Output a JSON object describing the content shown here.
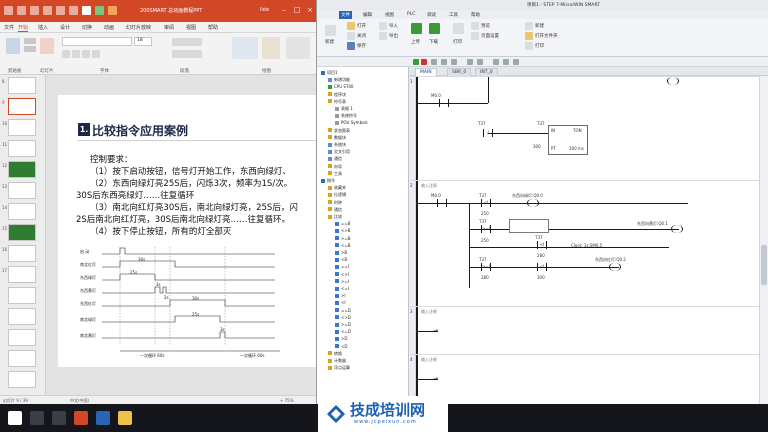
{
  "ppt": {
    "title": "200SMART 总动画教程PPT",
    "user": "lide",
    "tabs": [
      "文件",
      "开始",
      "插入",
      "设计",
      "切换",
      "动画",
      "幻灯片放映",
      "审阅",
      "视图",
      "帮助"
    ],
    "active_tab": "开始",
    "ribbon_groups": [
      "剪贴板",
      "幻灯片",
      "字体",
      "段落",
      "绘图"
    ],
    "ribbon_buttons": {
      "paste": "粘贴",
      "new_slide": "新建\n幻灯片",
      "font_size": "18"
    },
    "thumb_numbers": [
      "8",
      "9",
      "10",
      "11",
      "12",
      "13",
      "14",
      "15",
      "16",
      "17"
    ],
    "selected_thumb": "9",
    "slide": {
      "badge": "1.",
      "title": "比较指令应用案例",
      "heading": "控制要求：",
      "lines": [
        "（1）按下启动按钮，信号灯开始工作，东西向绿灯、",
        "（2）东西向绿灯亮25S后，闪烁3次，频率为1S/次。",
        "30S后东西亮绿灯……往复循环",
        "（3）南北向红灯亮30S后，南北向绿灯亮，25S后，闪",
        "2S后南北向红灯亮，30S后南北向绿灯亮……往复循环。",
        "（4）按下停止按钮，所有的灯全部灭"
      ],
      "timing_rows": [
        "启  动",
        "南北红灯",
        "东西绿灯",
        "东西黄灯",
        "东西红灯",
        "南北绿灯",
        "南北黄灯"
      ],
      "timing_labels": [
        "30s",
        "25s",
        "3s",
        "2s",
        "30s",
        "25s",
        "3s",
        "一次循环 60s",
        "一次循环 60s"
      ]
    },
    "status": {
      "left": "幻灯片 9 / 39",
      "lang": "中文(中国)",
      "zoom": "+ 75%"
    }
  },
  "plc": {
    "title": "项目1 - STEP 7-Micro/WIN SMART",
    "menu": [
      "文件",
      "编辑",
      "视图",
      "PLC",
      "调试",
      "工具",
      "帮助"
    ],
    "ribbon": {
      "buttons": [
        "新建",
        "打开",
        "关闭",
        "保存",
        "导入",
        "导出",
        "上传",
        "下载",
        "打印",
        "预览",
        "页面设置"
      ],
      "right_items": [
        "新建",
        "打开文件夹",
        "打印"
      ]
    },
    "editor_tabs": [
      "MAIN",
      "SBR_0",
      "INT_0"
    ],
    "active_editor_tab": "MAIN",
    "tree": [
      {
        "label": "项目1",
        "depth": 0,
        "color": "#2b6cc4"
      },
      {
        "label": "新增功能",
        "depth": 1,
        "color": "#5b8ed6"
      },
      {
        "label": "CPU ST40",
        "depth": 1,
        "color": "#3a9a3a"
      },
      {
        "label": "程序块",
        "depth": 1,
        "color": "#d9a321"
      },
      {
        "label": "符号表",
        "depth": 1,
        "color": "#d9a321"
      },
      {
        "label": "表格 1",
        "depth": 2,
        "color": "#9a9a9a"
      },
      {
        "label": "系统符号",
        "depth": 2,
        "color": "#9a9a9a"
      },
      {
        "label": "POU Symbols",
        "depth": 2,
        "color": "#9a9a9a"
      },
      {
        "label": "状态图表",
        "depth": 1,
        "color": "#d9a321"
      },
      {
        "label": "数据块",
        "depth": 1,
        "color": "#d9a321"
      },
      {
        "label": "系统块",
        "depth": 1,
        "color": "#5b8ed6"
      },
      {
        "label": "交叉引用",
        "depth": 1,
        "color": "#5b8ed6"
      },
      {
        "label": "通信",
        "depth": 1,
        "color": "#5b8ed6"
      },
      {
        "label": "向导",
        "depth": 1,
        "color": "#d9a321"
      },
      {
        "label": "工具",
        "depth": 1,
        "color": "#d9a321"
      },
      {
        "label": "指令",
        "depth": 0,
        "color": "#2b6cc4"
      },
      {
        "label": "收藏夹",
        "depth": 1,
        "color": "#d9a321"
      },
      {
        "label": "位逻辑",
        "depth": 1,
        "color": "#d9a321"
      },
      {
        "label": "时钟",
        "depth": 1,
        "color": "#d9a321"
      },
      {
        "label": "通信",
        "depth": 1,
        "color": "#d9a321"
      },
      {
        "label": "比较",
        "depth": 1,
        "color": "#d9a321"
      },
      {
        "label": "==B",
        "depth": 2,
        "color": "#3d78c8"
      },
      {
        "label": "<>B",
        "depth": 2,
        "color": "#3d78c8"
      },
      {
        "label": ">=B",
        "depth": 2,
        "color": "#3d78c8"
      },
      {
        "label": "<=B",
        "depth": 2,
        "color": "#3d78c8"
      },
      {
        "label": ">B",
        "depth": 2,
        "color": "#3d78c8"
      },
      {
        "label": "<B",
        "depth": 2,
        "color": "#3d78c8"
      },
      {
        "label": "==I",
        "depth": 2,
        "color": "#3d78c8"
      },
      {
        "label": "<>I",
        "depth": 2,
        "color": "#3d78c8"
      },
      {
        "label": ">=I",
        "depth": 2,
        "color": "#3d78c8"
      },
      {
        "label": "<=I",
        "depth": 2,
        "color": "#3d78c8"
      },
      {
        "label": ">I",
        "depth": 2,
        "color": "#3d78c8"
      },
      {
        "label": "<I",
        "depth": 2,
        "color": "#3d78c8"
      },
      {
        "label": "==D",
        "depth": 2,
        "color": "#3d78c8"
      },
      {
        "label": "<>D",
        "depth": 2,
        "color": "#3d78c8"
      },
      {
        "label": ">=D",
        "depth": 2,
        "color": "#3d78c8"
      },
      {
        "label": "<=D",
        "depth": 2,
        "color": "#3d78c8"
      },
      {
        "label": ">D",
        "depth": 2,
        "color": "#3d78c8"
      },
      {
        "label": "<D",
        "depth": 2,
        "color": "#3d78c8"
      },
      {
        "label": "转换",
        "depth": 1,
        "color": "#d9a321"
      },
      {
        "label": "计数器",
        "depth": 1,
        "color": "#d9a321"
      },
      {
        "label": "浮点运算",
        "depth": 1,
        "color": "#d9a321"
      }
    ],
    "networks": [
      {
        "num": "1",
        "comment": "",
        "contacts": [
          "M0.0"
        ]
      },
      {
        "num": "2",
        "comment": "输入注释",
        "contacts": [
          "M0.0",
          "T37",
          "T37",
          "T37",
          "T37"
        ],
        "coils": [
          "东西向绿灯:Q0.0",
          "东西向黄灯:Q0.1",
          "东西向红灯:Q0.2"
        ],
        "compare_values": [
          "250",
          "250",
          "280",
          "280",
          "300"
        ],
        "clock": "Clock_1s:SM0.5"
      },
      {
        "num": "3",
        "comment": "输入注释"
      },
      {
        "num": "4",
        "comment": "输入注释"
      }
    ],
    "net1": {
      "timer": "T37",
      "timer_type": "TON",
      "in": "IN",
      "pt": "PT",
      "pt_value": "300",
      "unit": "100 ms",
      "contact": "T37"
    }
  },
  "brand": {
    "title": "技成培训网",
    "sub": "www.jcpeixun.com"
  }
}
